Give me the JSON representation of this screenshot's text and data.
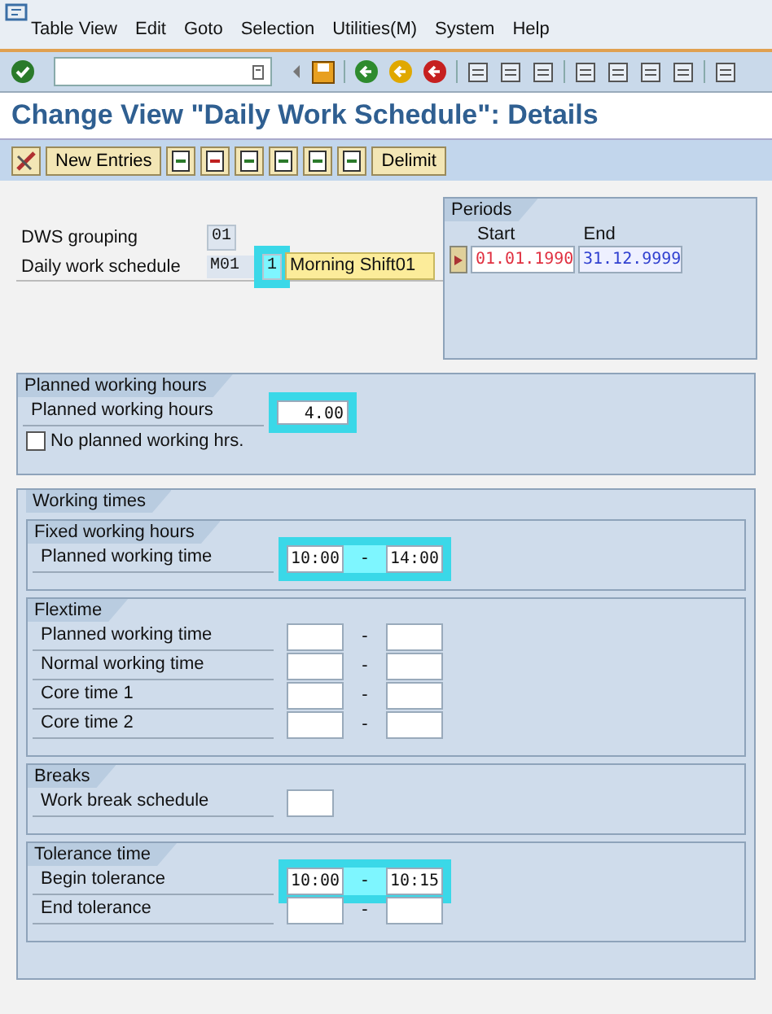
{
  "menu": [
    "Table View",
    "Edit",
    "Goto",
    "Selection",
    "Utilities(M)",
    "System",
    "Help"
  ],
  "title": "Change View \"Daily Work Schedule\": Details",
  "app_buttons": [
    "New Entries",
    "Delimit"
  ],
  "dws_grouping": {
    "label": "DWS grouping",
    "value": "01"
  },
  "daily_work_schedule": {
    "label": "Daily work schedule",
    "code": "M01",
    "variant": "1",
    "variant_highlighted": true,
    "text": "Morning Shift01"
  },
  "periods": {
    "title": "Periods",
    "start_label": "Start",
    "end_label": "End",
    "start": "01.01.1990",
    "end": "31.12.9999"
  },
  "planned_hours": {
    "title": "Planned working hours",
    "label": "Planned working hours",
    "value": "4.00",
    "highlighted": true,
    "checkbox": {
      "label": "No planned working hrs.",
      "checked": false
    }
  },
  "working_times": {
    "title": "Working times",
    "groups": [
      {
        "title": "Fixed working hours",
        "rows": [
          {
            "kind": "range",
            "label": "Planned working time",
            "from": "10:00",
            "separator": "-",
            "to": "14:00",
            "highlighted": true
          }
        ]
      },
      {
        "title": "Flextime",
        "rows": [
          {
            "kind": "range",
            "label": "Planned working time",
            "separator": "-",
            "highlighted": false
          },
          {
            "kind": "range",
            "label": "Normal working time",
            "separator": "-",
            "highlighted": false
          },
          {
            "kind": "range",
            "label": "Core time 1",
            "separator": "-",
            "highlighted": false
          },
          {
            "kind": "range",
            "label": "Core time 2",
            "separator": "-",
            "highlighted": false
          }
        ]
      },
      {
        "title": "Breaks",
        "rows": [
          {
            "kind": "single",
            "label": "Work break schedule",
            "highlighted": false
          }
        ]
      },
      {
        "title": "Tolerance time",
        "rows": [
          {
            "kind": "range",
            "label": "Begin tolerance",
            "from": "10:00",
            "separator": "-",
            "to": "10:15",
            "highlighted": true
          },
          {
            "kind": "range",
            "label": "End tolerance",
            "separator": "-",
            "highlighted": false
          }
        ]
      }
    ]
  }
}
